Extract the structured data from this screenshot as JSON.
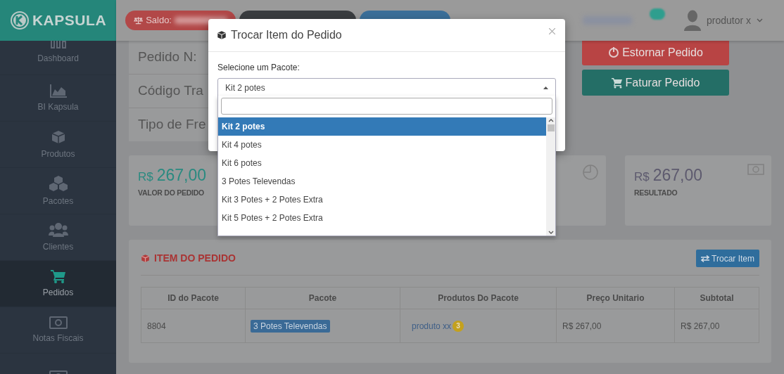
{
  "topbar": {
    "logo": "KAPSULA",
    "balance_label": "Saldo:",
    "user": "produtor x"
  },
  "sidebar": {
    "items": [
      {
        "label": "Dashboard",
        "kind": "bars",
        "selected": false
      },
      {
        "label": "BI Kapsula",
        "kind": "area",
        "selected": false
      },
      {
        "label": "Produtos",
        "kind": "cube",
        "selected": false
      },
      {
        "label": "Pacotes",
        "kind": "cubes",
        "selected": false
      },
      {
        "label": "Clientes",
        "kind": "users",
        "selected": false
      },
      {
        "label": "Pedidos",
        "kind": "cart",
        "selected": true
      },
      {
        "label": "Notas Fiscais",
        "kind": "money",
        "selected": false
      },
      {
        "kind": "money",
        "selected": false
      }
    ]
  },
  "order_panel": {
    "lines": [
      "Pedido N:",
      "Código Tra",
      "Tipo de Fre"
    ]
  },
  "actions": [
    {
      "label": "Estornar Pedido",
      "kind": "danger"
    },
    {
      "label": "Faturar Pedido",
      "kind": "success"
    }
  ],
  "stats": [
    {
      "kind": "order",
      "currency": "R$",
      "value": "267,00",
      "label": "VALOR DO PEDIDO"
    },
    {
      "kind": "pie"
    },
    {
      "kind": "result",
      "currency": "R$",
      "value": "267,00",
      "label": "RESULTADO"
    }
  ],
  "items_section": {
    "title": "ITEM DO PEDIDO",
    "button": "Trocar Item",
    "table": {
      "columns": [
        "ID do Pacote",
        "Pacote",
        "Produtos Do Pacote",
        "Preço Unitario",
        "Subtotal"
      ],
      "rows": [
        {
          "id": "8804",
          "package": "3 Potes Televendas",
          "product": "produto xx",
          "product_count": "3",
          "unit_price": "R$ 267,00",
          "subtotal": "R$ 267,00"
        }
      ]
    }
  },
  "modal": {
    "title": "Trocar Item do Pedido",
    "field_label": "Selecione um Pacote:",
    "select": {
      "value": "Kit 2 potes",
      "expanded": true
    },
    "options": [
      {
        "label": "Kit 2 potes",
        "selected": true
      },
      {
        "label": "Kit 4 potes",
        "selected": false
      },
      {
        "label": "Kit 6 potes",
        "selected": false
      },
      {
        "label": "3 Potes Televendas",
        "selected": false
      },
      {
        "label": "Kit 3 Potes + 2 Potes Extra",
        "selected": false
      },
      {
        "label": "Kit 5 Potes + 2 Potes Extra",
        "selected": false
      }
    ]
  }
}
